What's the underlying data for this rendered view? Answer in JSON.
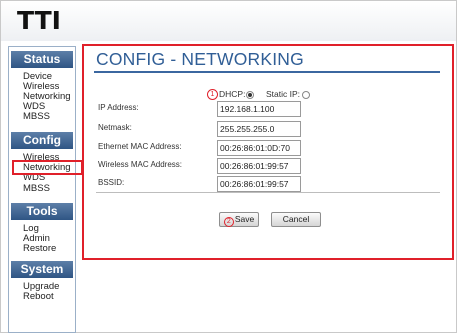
{
  "brand": {
    "logo_text": "TTI"
  },
  "sidebar": {
    "sections": [
      {
        "title": "Status",
        "items": [
          "Device",
          "Wireless",
          "Networking",
          "WDS",
          "MBSS"
        ]
      },
      {
        "title": "Config",
        "items": [
          "Wireless",
          "Networking",
          "WDS",
          "MBSS"
        ]
      },
      {
        "title": "Tools",
        "items": [
          "Log",
          "Admin",
          "Restore"
        ]
      },
      {
        "title": "System",
        "items": [
          "Upgrade",
          "Reboot"
        ]
      }
    ]
  },
  "main": {
    "title": "CONFIG - NETWORKING",
    "markers": {
      "first": "1",
      "second": "2"
    },
    "ip_mode": {
      "dhcp_label": "DHCP:",
      "static_label": "Static IP:",
      "selected": "DHCP"
    },
    "fields": [
      {
        "label": "IP Address:",
        "value": "192.168.1.100"
      },
      {
        "label": "Netmask:",
        "value": "255.255.255.0"
      },
      {
        "label": "Ethernet MAC Address:",
        "value": "00:26:86:01:0D:70"
      },
      {
        "label": "Wireless MAC Address:",
        "value": "00:26:86:01:99:57"
      },
      {
        "label": "BSSID:",
        "value": "00:26:86:01:99:57"
      }
    ],
    "buttons": {
      "save": "Save",
      "cancel": "Cancel"
    }
  },
  "colors": {
    "accent": "#305e96",
    "highlight": "#e0202a",
    "section_header": "#3a6191"
  }
}
